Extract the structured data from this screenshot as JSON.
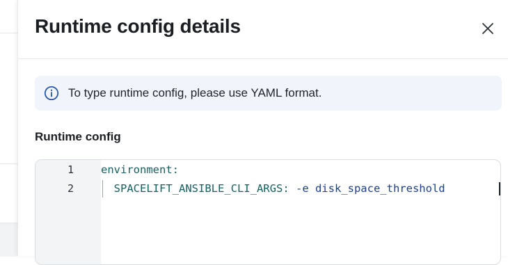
{
  "drawer": {
    "title": "Runtime config details",
    "close_icon": "close-icon"
  },
  "info_banner": {
    "icon": "info-circle-icon",
    "text": "To type runtime config, please use YAML format."
  },
  "section": {
    "label": "Runtime config"
  },
  "editor": {
    "lines": [
      {
        "number": "1",
        "text": "environment:"
      },
      {
        "number": "2",
        "indent": "  ",
        "key": "SPACELIFT_ANSIBLE_CLI_ARGS",
        "separator": ": ",
        "value": "-e disk_space_threshold"
      }
    ]
  },
  "colors": {
    "yaml_key": "#17605f",
    "yaml_value": "#1d3f91",
    "info_banner_bg": "#f1f5fb",
    "info_icon": "#1f4fa8"
  }
}
